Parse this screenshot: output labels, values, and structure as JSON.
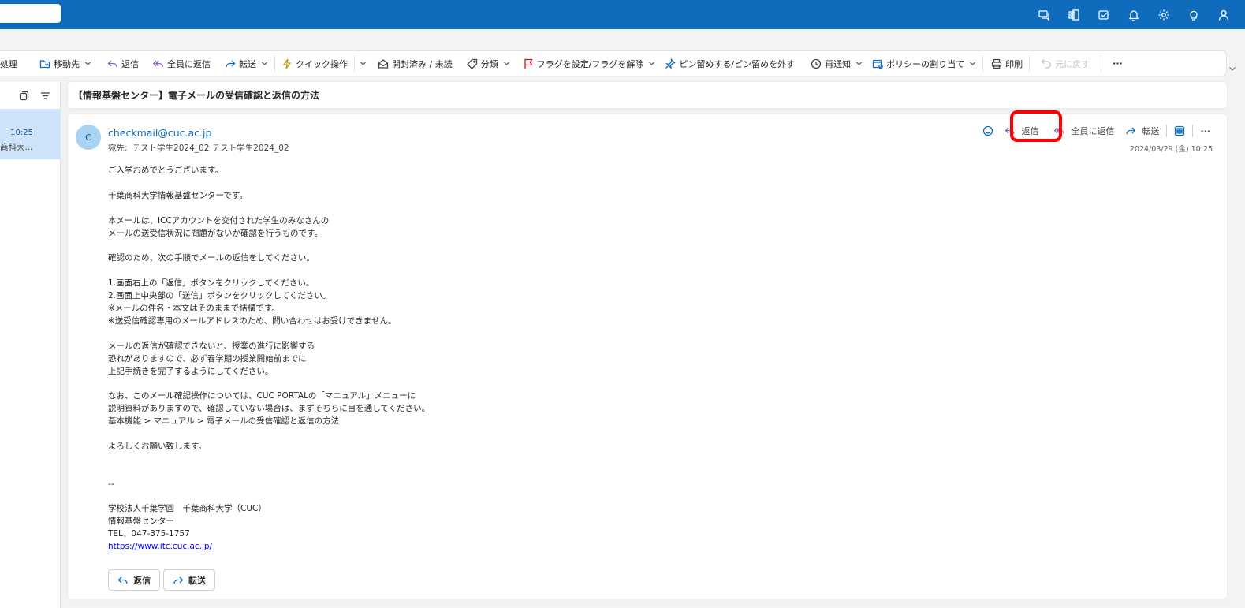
{
  "colors": {
    "brand": "#0f6cbd",
    "selection": "#cfe4fa",
    "highlight": "#ff0000"
  },
  "topbar": {
    "icons": [
      "teams-chat-icon",
      "outlook-icon",
      "todo-icon",
      "bell-icon",
      "gear-icon",
      "lightbulb-icon",
      "person-icon"
    ]
  },
  "ribbon": {
    "handle": "処理",
    "move": "移動先",
    "reply": "返信",
    "reply_all": "全員に返信",
    "forward": "転送",
    "quick_steps": "クイック操作",
    "read_unread": "開封済み / 未読",
    "categorize": "分類",
    "flag": "フラグを設定/フラグを解除",
    "pin": "ピン留めする/ピン留めを外す",
    "snooze": "再通知",
    "policy": "ポリシーの割り当て",
    "print": "印刷",
    "undo": "元に戻す",
    "more": "···"
  },
  "list": {
    "time": "10:25",
    "sender_snippet": "商科大..."
  },
  "message": {
    "subject": "【情報基盤センター】電子メールの受信確認と返信の方法",
    "avatar_initial": "C",
    "from": "checkmail@cuc.ac.jp",
    "to_label": "宛先:",
    "to": "テスト学生2024_02 テスト学生2024_02",
    "date": "2024/03/29 (金) 10:25",
    "actions": {
      "reply": "返信",
      "reply_all": "全員に返信",
      "forward": "転送",
      "more": "···"
    },
    "body": "ご入学おめでとうございます。\n\n千葉商科大学情報基盤センターです。\n\n本メールは、ICCアカウントを交付された学生のみなさんの\nメールの送受信状況に問題がないか確認を行うものです。\n\n確認のため、次の手順でメールの返信をしてください。\n\n1.画面右上の「返信」ボタンをクリックしてください。\n2.画面上中央部の「送信」ボタンをクリックしてください。\n※メールの件名・本文はそのままで結構です。\n※送受信確認専用のメールアドレスのため、問い合わせはお受けできません。\n\nメールの返信が確認できないと、授業の進行に影響する\n恐れがありますので、必ず春学期の授業開始前までに\n上記手続きを完了するようにしてください。\n\nなお、このメール確認操作については、CUC PORTALの「マニュアル」メニューに\n説明資料がありますので、確認していない場合は、まずそちらに目を通してください。\n基本機能 > マニュアル > 電子メールの受信確認と返信の方法\n\nよろしくお願い致します。\n\n\n--\n\n学校法人千葉学園　千葉商科大学（CUC）\n情報基盤センター\nTEL：047-375-1757",
    "link": "https://www.itc.cuc.ac.jp/",
    "bottom_reply": "返信",
    "bottom_forward": "転送"
  }
}
